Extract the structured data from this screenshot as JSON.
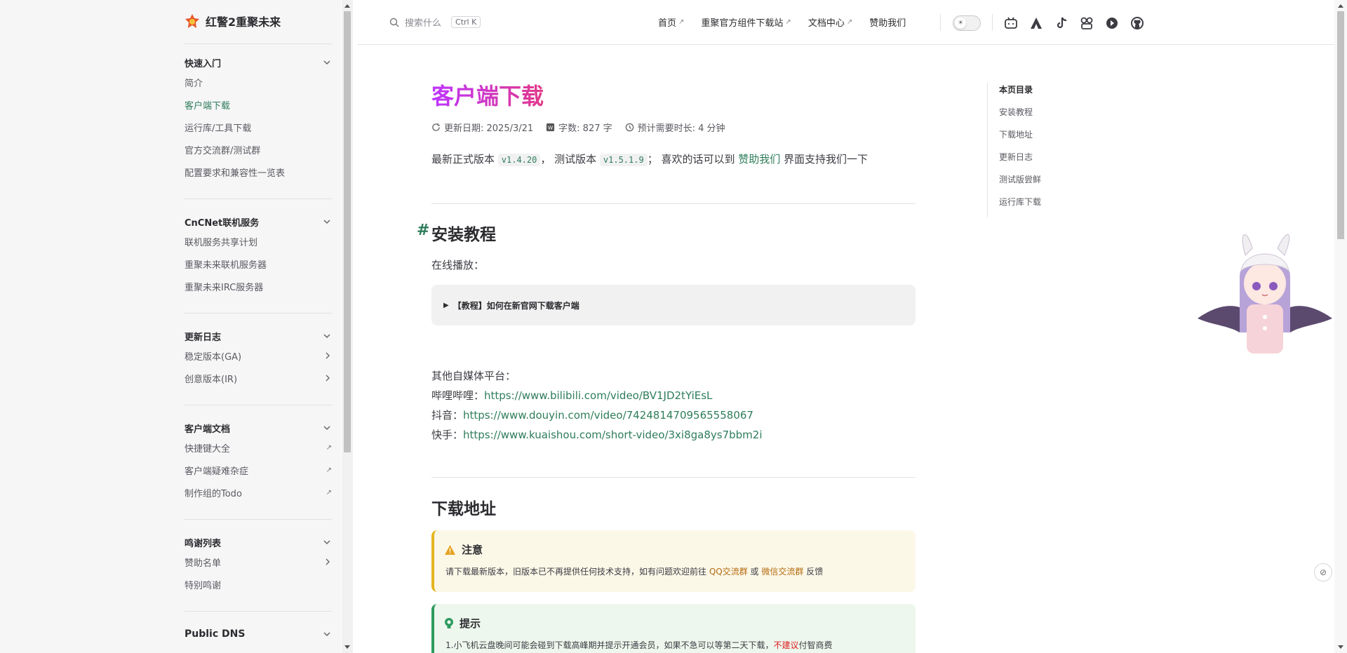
{
  "brand": {
    "title": "红警2重聚未来"
  },
  "sidebar": {
    "groups": [
      {
        "title": "快速入门",
        "items": [
          {
            "label": "简介"
          },
          {
            "label": "客户端下载"
          },
          {
            "label": "运行库/工具下载"
          },
          {
            "label": "官方交流群/测试群"
          },
          {
            "label": "配置要求和兼容性一览表"
          }
        ]
      },
      {
        "title": "CnCNet联机服务",
        "items": [
          {
            "label": "联机服务共享计划"
          },
          {
            "label": "重聚未来联机服务器"
          },
          {
            "label": "重聚未来IRC服务器"
          }
        ]
      },
      {
        "title": "更新日志",
        "items": [
          {
            "label": "稳定版本(GA)"
          },
          {
            "label": "创意版本(IR)"
          }
        ]
      },
      {
        "title": "客户端文档",
        "items": [
          {
            "label": "快捷键大全"
          },
          {
            "label": "客户端疑难杂症"
          },
          {
            "label": "制作组的Todo"
          }
        ]
      },
      {
        "title": "鸣谢列表",
        "items": [
          {
            "label": "赞助名单"
          },
          {
            "label": "特别鸣谢"
          }
        ]
      },
      {
        "title": "Public DNS",
        "items": []
      }
    ]
  },
  "topnav": {
    "search_placeholder": "搜索什么",
    "search_shortcut": "Ctrl K",
    "links": [
      {
        "label": "首页",
        "ext": "↗"
      },
      {
        "label": "重聚官方组件下载站",
        "ext": "↗"
      },
      {
        "label": "文档中心",
        "ext": "↗"
      },
      {
        "label": "赞助我们",
        "ext": ""
      }
    ],
    "social_icons": [
      "bilibili-icon",
      "acfun-icon",
      "tiktok-icon",
      "kuaishou-icon",
      "kook-icon",
      "github-icon"
    ]
  },
  "page": {
    "title": "客户端下载",
    "meta": {
      "updated": "更新日期: 2025/3/21",
      "words": "字数: 827 字",
      "duration": "预计需要时长: 4 分钟"
    },
    "intro": {
      "prefix": "最新正式版本 ",
      "stable_version": "v1.4.20",
      "mid": "， 测试版本 ",
      "beta_version": "v1.5.1.9",
      "mid2": "； 喜欢的话可以到 ",
      "sponsor_link": "赞助我们",
      "suffix": " 界面支持我们一下"
    },
    "install": {
      "heading": "安装教程",
      "hash": "#",
      "online_label": "在线播放：",
      "details_summary": "【教程】如何在新官网下载客户端",
      "other_platforms": "其他自媒体平台：",
      "bilibili_label": "哔哩哔哩：",
      "bilibili_url": "https://www.bilibili.com/video/BV1JD2tYiEsL",
      "douyin_label": "抖音：",
      "douyin_url": "https://www.douyin.com/video/7424814709565558067",
      "kuaishou_label": "快手：",
      "kuaishou_url": "https://www.kuaishou.com/short-video/3xi8ga8ys7bbm2i"
    },
    "download": {
      "heading": "下载地址",
      "warning_title": "注意",
      "warning_text_1": "请下载最新版本，旧版本已不再提供任何技术支持，如有问题欢迎前往 ",
      "warning_link_qq": "QQ交流群",
      "warning_text_2": " 或 ",
      "warning_link_wx": "微信交流群",
      "warning_text_3": " 反馈",
      "tip_title": "提示",
      "tip_text_1": "1.小飞机云盘晚间可能会碰到下载高峰期并提示开通会员，如果不急可以等第二天下载，",
      "tip_text_red": "不建议",
      "tip_text_2": "付智商费"
    }
  },
  "outline": {
    "title": "本页目录",
    "items": [
      "安装教程",
      "下载地址",
      "更新日志",
      "测试版尝鲜",
      "运行库下载"
    ]
  },
  "colors": {
    "accent": "#2e7d5b",
    "title_gradient_start": "#bd34fe",
    "title_gradient_end": "#e23a8a"
  }
}
